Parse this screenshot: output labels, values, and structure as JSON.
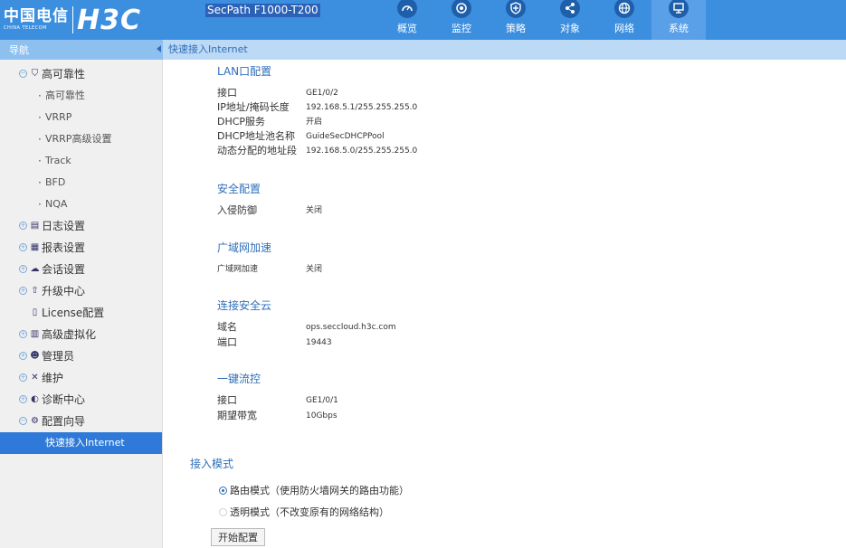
{
  "header": {
    "logo_cn": "中国电信",
    "logo_en": "CHINA TELECOM",
    "logo_brand": "H3C",
    "product": "SecPath F1000-T200",
    "tabs": [
      {
        "label": "概览",
        "icon": "dashboard-icon",
        "active": false
      },
      {
        "label": "监控",
        "icon": "monitor-icon",
        "active": false
      },
      {
        "label": "策略",
        "icon": "shield-icon",
        "active": false
      },
      {
        "label": "对象",
        "icon": "share-icon",
        "active": false
      },
      {
        "label": "网络",
        "icon": "globe-icon",
        "active": false
      },
      {
        "label": "系统",
        "icon": "display-icon",
        "active": true
      }
    ]
  },
  "subbar": {
    "nav_label": "导航",
    "breadcrumb": "快速接入Internet"
  },
  "sidebar": {
    "items": [
      {
        "label": "高可靠性",
        "icon": "shield-icon",
        "expanded": true
      },
      {
        "label": "高可靠性",
        "sub": true
      },
      {
        "label": "VRRP",
        "sub": true
      },
      {
        "label": "VRRP高级设置",
        "sub": true
      },
      {
        "label": "Track",
        "sub": true
      },
      {
        "label": "BFD",
        "sub": true
      },
      {
        "label": "NQA",
        "sub": true
      },
      {
        "label": "日志设置",
        "icon": "log-icon"
      },
      {
        "label": "报表设置",
        "icon": "report-icon"
      },
      {
        "label": "会话设置",
        "icon": "session-icon"
      },
      {
        "label": "升级中心",
        "icon": "upgrade-icon"
      },
      {
        "label": "License配置",
        "icon": "license-icon"
      },
      {
        "label": "高级虚拟化",
        "icon": "virtual-icon"
      },
      {
        "label": "管理员",
        "icon": "admin-icon"
      },
      {
        "label": "维护",
        "icon": "tools-icon"
      },
      {
        "label": "诊断中心",
        "icon": "diagnose-icon"
      },
      {
        "label": "配置向导",
        "icon": "gear-icon",
        "expanded": true
      },
      {
        "label": "快速接入Internet",
        "sub": true,
        "active": true
      }
    ]
  },
  "content": {
    "lan": {
      "title": "LAN口配置",
      "rows": [
        {
          "k": "接口",
          "v": "GE1/0/2"
        },
        {
          "k": "IP地址/掩码长度",
          "v": "192.168.5.1/255.255.255.0"
        },
        {
          "k": "DHCP服务",
          "v": "开启"
        },
        {
          "k": "DHCP地址池名称",
          "v": "GuideSecDHCPPool"
        },
        {
          "k": "动态分配的地址段",
          "v": "192.168.5.0/255.255.255.0"
        }
      ]
    },
    "security": {
      "title": "安全配置",
      "rows": [
        {
          "k": "入侵防御",
          "v": "关闭"
        }
      ]
    },
    "wan": {
      "title": "广域网加速",
      "rows": [
        {
          "k": "广域网加速",
          "v": "关闭"
        }
      ]
    },
    "cloud": {
      "title": "连接安全云",
      "rows": [
        {
          "k": "域名",
          "v": "ops.seccloud.h3c.com"
        },
        {
          "k": "端口",
          "v": "19443"
        }
      ]
    },
    "flow": {
      "title": "一键流控",
      "rows": [
        {
          "k": "接口",
          "v": "GE1/0/1"
        },
        {
          "k": "期望带宽",
          "v": "10Gbps"
        }
      ]
    },
    "mode": {
      "title": "接入模式",
      "route_label": "路由模式（使用防火墙网关的路由功能）",
      "transparent_label": "透明模式（不改变原有的网络结构）",
      "selected": "route"
    },
    "start_button": "开始配置"
  }
}
